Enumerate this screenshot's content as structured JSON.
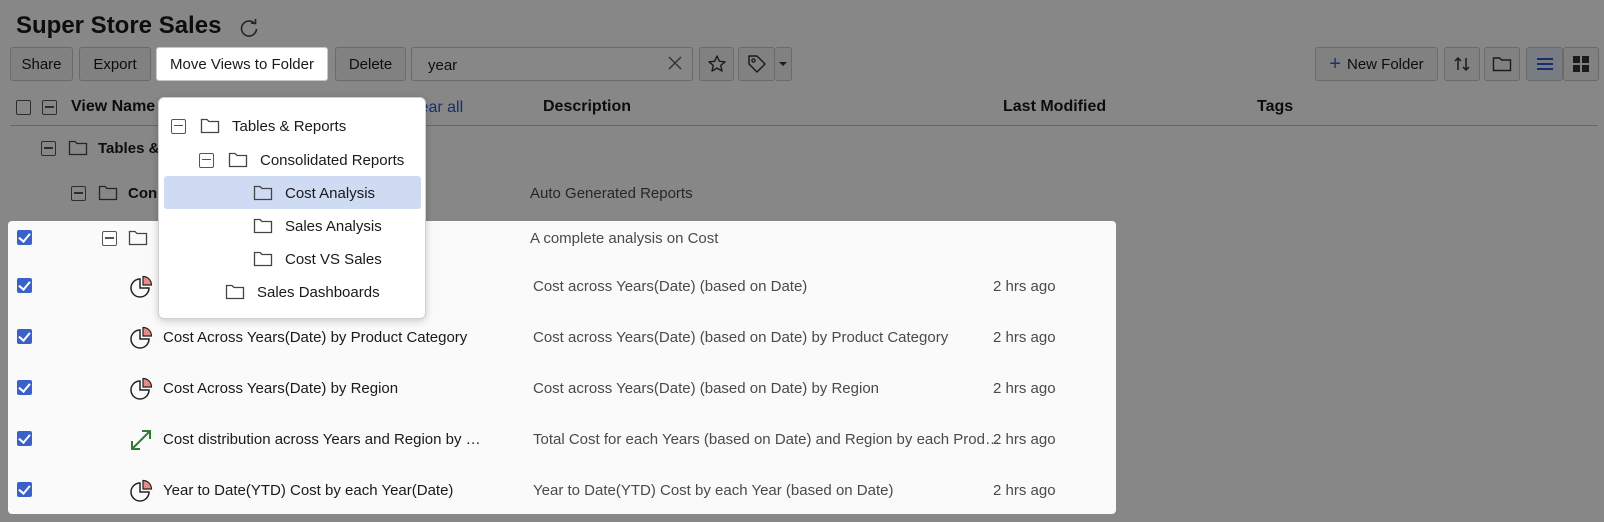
{
  "app": {
    "title": "Super Store Sales"
  },
  "toolbar": {
    "share": "Share",
    "export": "Export",
    "move": "Move Views to Folder",
    "delete": "Delete",
    "search_value": "year",
    "new_folder": "New Folder",
    "new_folder_plus": "+"
  },
  "columns": {
    "view_name": "View Name",
    "clear_all": "lear all",
    "description": "Description",
    "last_modified": "Last Modified",
    "tags": "Tags"
  },
  "tree": {
    "tables_reports": "Tables &",
    "consolidated": "Con",
    "consolidated_desc": "Auto Generated Reports",
    "cost_analysis_desc": "A complete analysis on Cost"
  },
  "rows": [
    {
      "name": "",
      "description": "Cost across Years(Date) (based on Date)",
      "modified": "2 hrs ago",
      "icon": "pie-chart-icon"
    },
    {
      "name": "Cost Across Years(Date) by Product Category",
      "description": "Cost across Years(Date) (based on Date) by Product Category",
      "modified": "2 hrs ago",
      "icon": "pie-chart-icon"
    },
    {
      "name": "Cost Across Years(Date) by Region",
      "description": "Cost across Years(Date) (based on Date) by Region",
      "modified": "2 hrs ago",
      "icon": "pie-chart-icon"
    },
    {
      "name": "Cost distribution across Years and Region by …",
      "description": "Total Cost for each Years (based on Date) and Region by each Prod…",
      "modified": "2 hrs ago",
      "icon": "expand-arrow-icon"
    },
    {
      "name": "Year to Date(YTD) Cost by each Year(Date)",
      "description": "Year to Date(YTD) Cost by each Year (based on Date)",
      "modified": "2 hrs ago",
      "icon": "pie-chart-icon"
    }
  ],
  "dropdown": {
    "items": [
      {
        "label": "Tables & Reports"
      },
      {
        "label": "Consolidated Reports"
      },
      {
        "label": "Cost Analysis"
      },
      {
        "label": "Sales Analysis"
      },
      {
        "label": "Cost VS Sales"
      },
      {
        "label": "Sales Dashboards"
      }
    ],
    "selected": "Cost Analysis"
  },
  "colors": {
    "accent": "#3a61c9",
    "selected_bg": "#cfdaf3",
    "link": "#2c5ccd"
  }
}
